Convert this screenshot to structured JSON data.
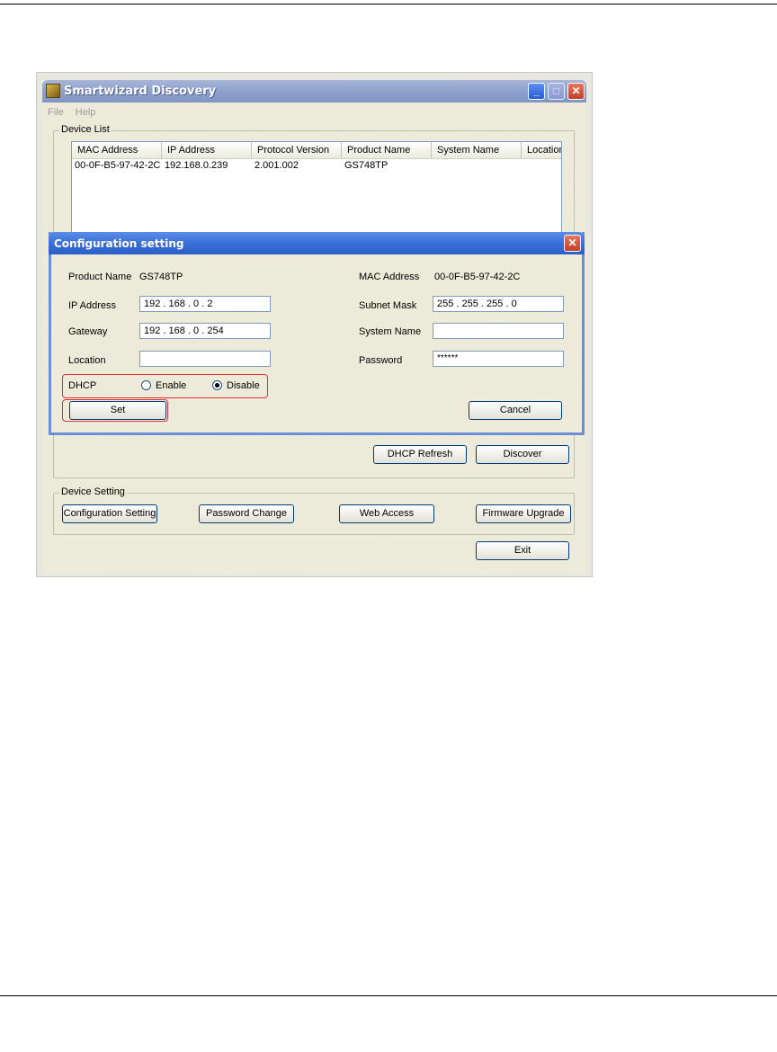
{
  "window": {
    "title": "Smartwizard Discovery",
    "menu": [
      "File",
      "Help"
    ],
    "controls": {
      "minimize": "_",
      "maximize": "□",
      "close": "✕"
    }
  },
  "device_list": {
    "group_label": "Device List",
    "columns": [
      "MAC Address",
      "IP Address",
      "Protocol Version",
      "Product Name",
      "System Name",
      "Location"
    ],
    "rows": [
      [
        "00-0F-B5-97-42-2C",
        "192.168.0.239",
        "2.001.002",
        "GS748TP",
        "",
        ""
      ]
    ]
  },
  "list_buttons": {
    "dhcp_refresh": "DHCP Refresh",
    "discover": "Discover"
  },
  "device_setting": {
    "group_label": "Device Setting",
    "buttons": [
      "Configuration Setting",
      "Password Change",
      "Web Access",
      "Firmware Upgrade"
    ]
  },
  "exit_label": "Exit",
  "dialog": {
    "title": "Configuration setting",
    "close": "✕",
    "product_name_label": "Product Name",
    "product_name_value": "GS748TP",
    "mac_label": "MAC Address",
    "mac_value": "00-0F-B5-97-42-2C",
    "ip_label": "IP Address",
    "ip_value": "192  .  168  .   0   .   2",
    "subnet_label": "Subnet Mask",
    "subnet_value": "255  .  255  .  255  .   0",
    "gateway_label": "Gateway",
    "gateway_value": "192  .  168  .   0   .  254",
    "system_name_label": "System Name",
    "system_name_value": "",
    "location_label": "Location",
    "location_value": "",
    "password_label": "Password",
    "password_value": "******",
    "dhcp_label": "DHCP",
    "dhcp_enable": "Enable",
    "dhcp_disable": "Disable",
    "dhcp_selected": "Disable",
    "set_label": "Set",
    "cancel_label": "Cancel"
  },
  "colors": {
    "highlight": "#dd3333",
    "titlebar_active": "#3a6fd8",
    "titlebar_inactive": "#8ea1cc"
  }
}
